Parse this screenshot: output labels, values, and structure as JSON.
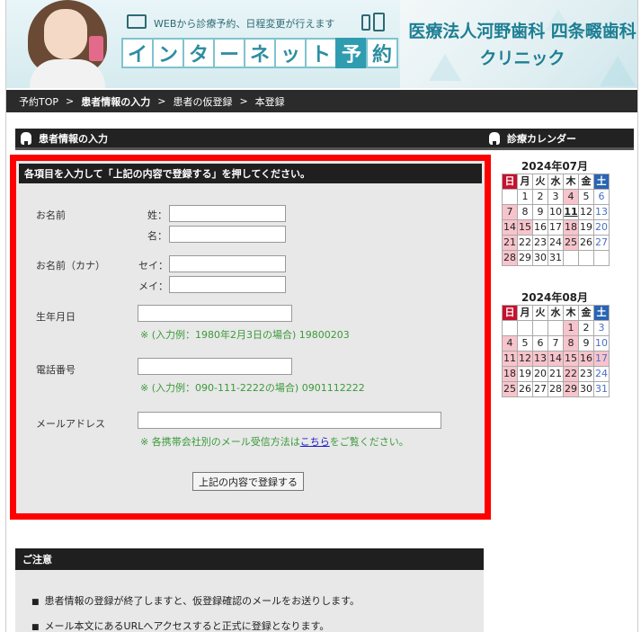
{
  "banner": {
    "subtitle": "WEBから診療予約、日程変更が行えます",
    "title_chars": [
      "イ",
      "ン",
      "タ",
      "ー",
      "ネ",
      "ッ",
      "ト",
      "予",
      "約"
    ],
    "clinic_name": "医療法人河野歯科 四条畷歯科クリニック"
  },
  "breadcrumb": [
    {
      "label": "予約TOP",
      "current": false
    },
    {
      "label": ">",
      "current": false
    },
    {
      "label": "患者情報の入力",
      "current": true
    },
    {
      "label": ">",
      "current": false
    },
    {
      "label": "患者の仮登録",
      "current": false
    },
    {
      "label": ">",
      "current": false
    },
    {
      "label": "本登録",
      "current": false
    }
  ],
  "main": {
    "section_title": "患者情報の入力",
    "form_instruction": "各項目を入力して「上記の内容で登録する」を押してください。",
    "fields": {
      "name_label": "お名前",
      "sei_label": "姓：",
      "mei_label": "名：",
      "kana_label": "お名前（カナ）",
      "sei_kana_label": "セイ：",
      "mei_kana_label": "メイ：",
      "birth_label": "生年月日",
      "birth_note": "※ (入力例：1980年2月3日の場合) 19800203",
      "phone_label": "電話番号",
      "phone_note": "※ (入力例：090-111-2222の場合) 0901112222",
      "email_label": "メールアドレス",
      "email_note_pre": "※ 各携帯会社別のメール受信方法は",
      "email_note_link": "こちら",
      "email_note_post": "をご覧ください。"
    },
    "submit_label": "上記の内容で登録する"
  },
  "caution": {
    "title": "ご注意",
    "items": [
      "患者情報の登録が終了しますと、仮登録確認のメールをお送りします。",
      "メール本文にあるURLへアクセスすると正式に登録となります。"
    ]
  },
  "sidebar": {
    "title": "診療カレンダー",
    "weekdays": [
      "日",
      "月",
      "火",
      "水",
      "木",
      "金",
      "土"
    ],
    "calendars": [
      {
        "title": "2024年07月",
        "rows": [
          [
            "",
            "1",
            "2",
            "3",
            "4",
            "5",
            "6"
          ],
          [
            "7",
            "8",
            "9",
            "10",
            "11",
            "12",
            "13"
          ],
          [
            "14",
            "15",
            "16",
            "17",
            "18",
            "19",
            "20"
          ],
          [
            "21",
            "22",
            "23",
            "24",
            "25",
            "26",
            "27"
          ],
          [
            "28",
            "29",
            "30",
            "31",
            "",
            "",
            ""
          ]
        ],
        "holidays": [
          "4",
          "7",
          "14",
          "15",
          "18",
          "21",
          "25",
          "28"
        ],
        "today": "11"
      },
      {
        "title": "2024年08月",
        "rows": [
          [
            "",
            "",
            "",
            "",
            "1",
            "2",
            "3"
          ],
          [
            "4",
            "5",
            "6",
            "7",
            "8",
            "9",
            "10"
          ],
          [
            "11",
            "12",
            "13",
            "14",
            "15",
            "16",
            "17"
          ],
          [
            "18",
            "19",
            "20",
            "21",
            "22",
            "23",
            "24"
          ],
          [
            "25",
            "26",
            "27",
            "28",
            "29",
            "30",
            "31"
          ]
        ],
        "holidays": [
          "1",
          "4",
          "8",
          "11",
          "12",
          "13",
          "14",
          "15",
          "16",
          "17",
          "18",
          "22",
          "25",
          "29"
        ],
        "today": ""
      }
    ]
  },
  "colors": {
    "highlight_border": "#ff0000",
    "note_green": "#3a9a3a",
    "holiday_pink": "#f7c4cc",
    "sunday_red": "#c8102e",
    "saturday_blue": "#2a64b4"
  }
}
